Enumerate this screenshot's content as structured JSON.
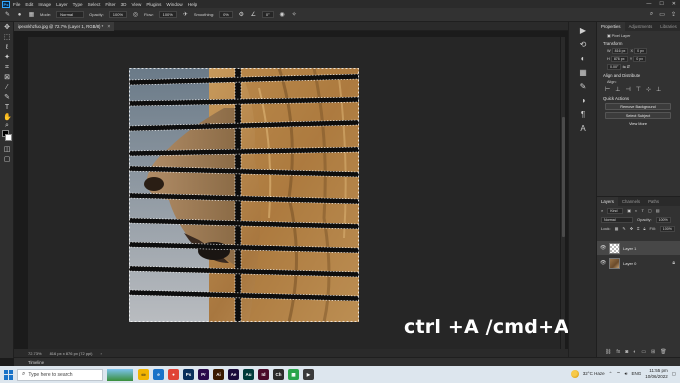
{
  "menubar": {
    "app_logo": "Ps",
    "items": [
      "File",
      "Edit",
      "Image",
      "Layer",
      "Type",
      "Select",
      "Filter",
      "3D",
      "View",
      "Plugins",
      "Window",
      "Help"
    ],
    "window_controls": [
      "—",
      "☐",
      "✕"
    ]
  },
  "options_bar": {
    "mode_label": "Mode:",
    "mode_value": "Normal",
    "opacity_label": "Opacity:",
    "opacity_value": "100%",
    "flow_label": "Flow:",
    "flow_value": "100%",
    "smoothing_label": "Smoothing:",
    "smoothing_value": "0%",
    "angle_value": "0°"
  },
  "document": {
    "tab_title": "ipexnkhzfuo.jpg @ 72.7% (Layer 1, RGB/8) *",
    "close_glyph": "×",
    "status_zoom": "72.73%",
    "status_info": "816 px x 876 px (72 ppi)",
    "caption": "ctrl +A /cmd+A"
  },
  "timeline": {
    "label": "Timeline"
  },
  "properties": {
    "tabs": [
      "Properties",
      "Adjustments",
      "Libraries"
    ],
    "pixel_layer_label": "Pixel Layer",
    "transform_title": "Transform",
    "width_value": "816 px",
    "height_value": "876 px",
    "x_value": "0 px",
    "y_value": "0 px",
    "angle_value": "0.00°",
    "align_title": "Align and Distribute",
    "align_label": "Align:",
    "quick_actions_title": "Quick Actions",
    "remove_background": "Remove Background",
    "select_subject": "Select Subject",
    "view_more": "View More"
  },
  "layers_panel": {
    "tabs": [
      "Layers",
      "Channels",
      "Paths"
    ],
    "kind_label": "Kind",
    "blend_mode": "Normal",
    "opacity_label": "Opacity:",
    "opacity_value": "100%",
    "lock_label": "Lock:",
    "fill_label": "Fill:",
    "fill_value": "100%",
    "layers": [
      {
        "name": "Layer 1",
        "selected": true
      },
      {
        "name": "Layer 0",
        "selected": false
      }
    ]
  },
  "taskbar": {
    "search_placeholder": "Type here to search",
    "apps": [
      {
        "label": "Ps",
        "color": "#0a2f5a"
      },
      {
        "label": "Pr",
        "color": "#2a0a4a"
      },
      {
        "label": "Ai",
        "color": "#3a1a00"
      },
      {
        "label": "Ae",
        "color": "#1a0a3a"
      },
      {
        "label": "Au",
        "color": "#003a3a"
      },
      {
        "label": "Id",
        "color": "#4a0a2a"
      },
      {
        "label": "Ch",
        "color": "#2a2a2a"
      }
    ],
    "weather": "32°C Haze",
    "language": "ENG",
    "time": "11:55 pm",
    "date": "10/06/2022"
  },
  "colors": {
    "accent": "#31a8ff",
    "panel_bg": "#323232",
    "canvas_bg": "#262626",
    "taskbar_bg": "#dde6ee"
  }
}
